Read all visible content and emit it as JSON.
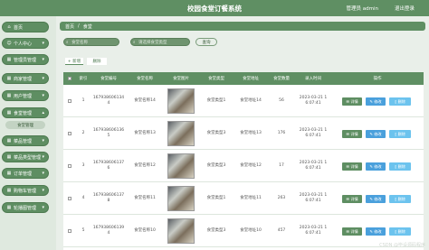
{
  "header": {
    "title": "校园食堂订餐系统",
    "user": "管理员 admin",
    "logout": "退出登录"
  },
  "sidebar": {
    "items": [
      {
        "label": "首页",
        "icon": "home-icon",
        "glyph": "⌂"
      },
      {
        "label": "个人中心",
        "icon": "person-icon",
        "glyph": "☺",
        "caret": "▾"
      },
      {
        "label": "管理员管理",
        "icon": "admin-icon",
        "glyph": "▦",
        "caret": "▾"
      },
      {
        "label": "商家管理",
        "icon": "shop-icon",
        "glyph": "▦",
        "caret": "▾"
      },
      {
        "label": "用户管理",
        "icon": "users-icon",
        "glyph": "▦",
        "caret": "▾"
      },
      {
        "label": "食堂管理",
        "icon": "canteen-icon",
        "glyph": "▦",
        "caret": "▴"
      },
      {
        "label": "菜品管理",
        "icon": "dish-icon",
        "glyph": "▦",
        "caret": "▾"
      },
      {
        "label": "菜品类型管理",
        "icon": "category-icon",
        "glyph": "▦",
        "caret": "▾"
      },
      {
        "label": "订单管理",
        "icon": "order-icon",
        "glyph": "▦",
        "caret": "▾"
      },
      {
        "label": "购物车管理",
        "icon": "cart-icon",
        "glyph": "▦",
        "caret": "▾"
      },
      {
        "label": "轮播图管理",
        "icon": "carousel-icon",
        "glyph": "▦",
        "caret": "▾"
      }
    ],
    "sub_item": "食堂管理"
  },
  "breadcrumb": {
    "home": "首页",
    "sep": "/",
    "current": "食堂"
  },
  "search": {
    "name_placeholder": "食堂名称",
    "type_placeholder": "请选择食堂类型",
    "query_label": "查询"
  },
  "actions": {
    "add_label": "+ 新增",
    "delete_label": "删除"
  },
  "table": {
    "headers": [
      "",
      "索引",
      "食堂编号",
      "食堂名称",
      "食堂图片",
      "食堂类型",
      "食堂地址",
      "食堂数量",
      "录入时间",
      "操作"
    ],
    "rows": [
      {
        "index": "1",
        "code": "167938606134\n4",
        "name": "食堂名称14",
        "type": "食堂类型1",
        "address": "食堂地址14",
        "qty": "56",
        "time": "2023-03-21 1\n6:07:41"
      },
      {
        "index": "2",
        "code": "167938606136\n5",
        "name": "食堂名称13",
        "type": "食堂类型3",
        "address": "食堂地址13",
        "qty": "176",
        "time": "2023-03-21 1\n6:07:41"
      },
      {
        "index": "3",
        "code": "167938606137\n6",
        "name": "食堂名称12",
        "type": "食堂类型3",
        "address": "食堂地址12",
        "qty": "17",
        "time": "2023-03-21 1\n6:07:41"
      },
      {
        "index": "4",
        "code": "167938606137\n8",
        "name": "食堂名称11",
        "type": "食堂类型1",
        "address": "食堂地址11",
        "qty": "263",
        "time": "2023-03-21 1\n6:07:41"
      },
      {
        "index": "5",
        "code": "167938606139\n4",
        "name": "食堂名称10",
        "type": "食堂类型3",
        "address": "食堂地址10",
        "qty": "457",
        "time": "2023-03-21 1\n6:07:41"
      }
    ],
    "btn_detail": "☰ 详情",
    "btn_edit": "✎ 修改",
    "btn_delete": "▯ 删除"
  },
  "watermark": "CSDN @毕设源码程序"
}
